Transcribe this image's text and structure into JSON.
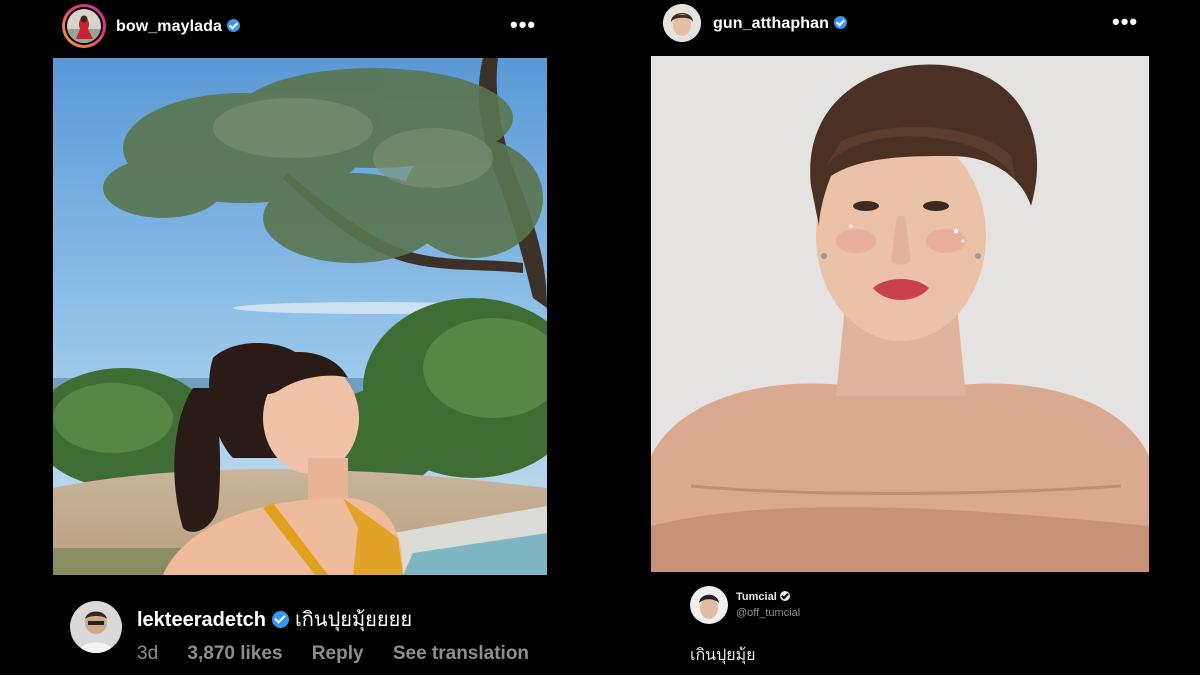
{
  "left_post": {
    "username": "bow_maylada",
    "more_label": "•••",
    "comment": {
      "username": "lekteeradetch",
      "text": "เกินปุยมุ้ยยยย",
      "age": "3d",
      "likes": "3,870 likes",
      "reply_label": "Reply",
      "translate_label": "See translation"
    }
  },
  "right_post": {
    "username": "gun_atthaphan",
    "more_label": "•••",
    "tweet": {
      "name": "Tumcial",
      "handle": "@off_tumcial",
      "text": "เกินปุยมุ้ย"
    }
  },
  "colors": {
    "background": "#000000",
    "verified": "#3897f0",
    "meta_text": "#8e8e8e"
  }
}
